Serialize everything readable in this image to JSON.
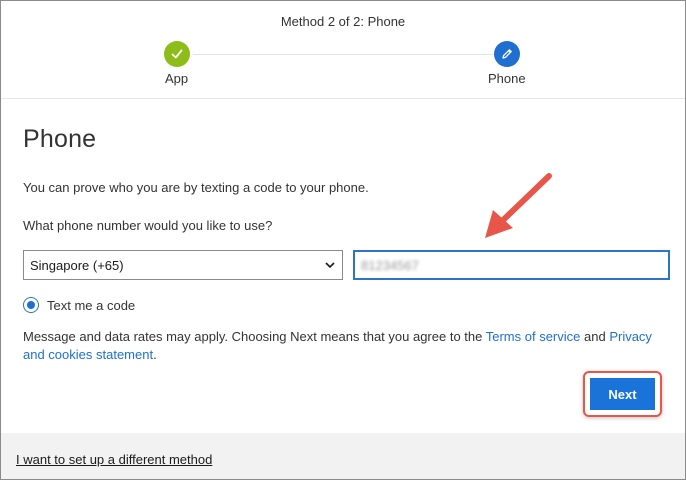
{
  "header": {
    "method_title": "Method 2 of 2: Phone",
    "steps": [
      {
        "label": "App",
        "state": "complete",
        "icon": "checkmark-icon",
        "color": "#8cbd18"
      },
      {
        "label": "Phone",
        "state": "current",
        "icon": "pencil-icon",
        "color": "#1f6fd0"
      }
    ]
  },
  "main": {
    "title": "Phone",
    "description": "You can prove who you are by texting a code to your phone.",
    "question": "What phone number would you like to use?",
    "country_select": {
      "value": "Singapore (+65)"
    },
    "phone_input": {
      "value": "81234567"
    },
    "radio_option": {
      "label": "Text me a code",
      "selected": true
    },
    "terms": {
      "prefix": "Message and data rates may apply. Choosing Next means that you agree to the ",
      "terms_link": "Terms of service",
      "middle": " and ",
      "privacy_link": "Privacy and cookies statement",
      "suffix": "."
    },
    "next_button": "Next"
  },
  "footer": {
    "alt_method_link": "I want to set up a different method"
  },
  "colors": {
    "accent": "#1f6fd0",
    "complete": "#8cbd18",
    "annotation": "#e8564a"
  }
}
